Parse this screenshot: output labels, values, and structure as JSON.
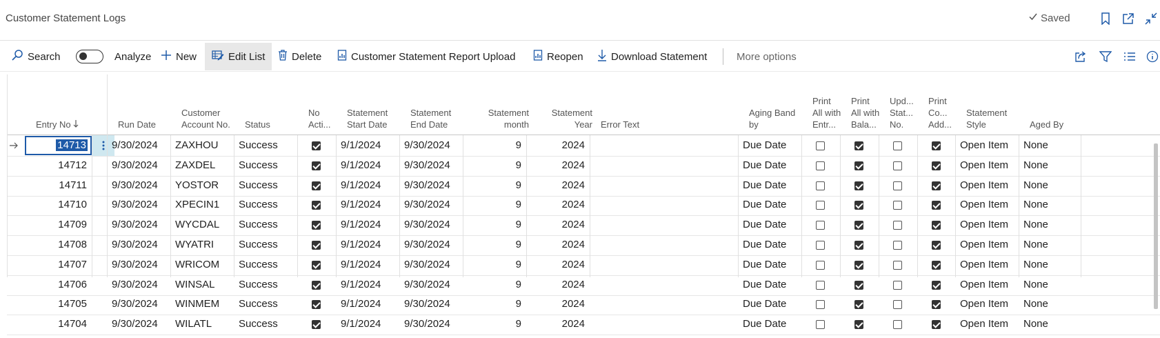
{
  "page": {
    "title": "Customer Statement Logs",
    "saved_label": "Saved"
  },
  "actions": {
    "search": "Search",
    "analyze": "Analyze",
    "new": "New",
    "edit_list": "Edit List",
    "delete": "Delete",
    "upload": "Customer Statement Report Upload",
    "reopen": "Reopen",
    "download": "Download Statement",
    "more": "More options"
  },
  "columns": {
    "entry_no": "Entry No",
    "run_date": "Run Date",
    "customer_account": "Customer Account No.",
    "status": "Status",
    "no_action": "No Acti...",
    "start_date": "Statement Start Date",
    "end_date": "Statement End Date",
    "month": "Statement month",
    "year": "Statement Year",
    "error": "Error Text",
    "aging_band": "Aging Band by",
    "print_all_entries": "Print All with Entr...",
    "print_all_balance": "Print All with Bala...",
    "update_stat": "Upd... Stat... No.",
    "print_company": "Print Co... Add...",
    "style": "Statement Style",
    "aged_by": "Aged By"
  },
  "rows": [
    {
      "entry": "14713",
      "run": "9/30/2024",
      "account": "ZAXHOU",
      "status": "Success",
      "no_action": true,
      "start": "9/1/2024",
      "end": "9/30/2024",
      "month": "9",
      "year": "2024",
      "error": "",
      "aging": "Due Date",
      "p_entries": false,
      "p_balance": true,
      "upd": false,
      "p_company": true,
      "style": "Open Item",
      "aged": "None"
    },
    {
      "entry": "14712",
      "run": "9/30/2024",
      "account": "ZAXDEL",
      "status": "Success",
      "no_action": true,
      "start": "9/1/2024",
      "end": "9/30/2024",
      "month": "9",
      "year": "2024",
      "error": "",
      "aging": "Due Date",
      "p_entries": false,
      "p_balance": true,
      "upd": false,
      "p_company": true,
      "style": "Open Item",
      "aged": "None"
    },
    {
      "entry": "14711",
      "run": "9/30/2024",
      "account": "YOSTOR",
      "status": "Success",
      "no_action": true,
      "start": "9/1/2024",
      "end": "9/30/2024",
      "month": "9",
      "year": "2024",
      "error": "",
      "aging": "Due Date",
      "p_entries": false,
      "p_balance": true,
      "upd": false,
      "p_company": true,
      "style": "Open Item",
      "aged": "None"
    },
    {
      "entry": "14710",
      "run": "9/30/2024",
      "account": "XPECIN1",
      "status": "Success",
      "no_action": true,
      "start": "9/1/2024",
      "end": "9/30/2024",
      "month": "9",
      "year": "2024",
      "error": "",
      "aging": "Due Date",
      "p_entries": false,
      "p_balance": true,
      "upd": false,
      "p_company": true,
      "style": "Open Item",
      "aged": "None"
    },
    {
      "entry": "14709",
      "run": "9/30/2024",
      "account": "WYCDAL",
      "status": "Success",
      "no_action": true,
      "start": "9/1/2024",
      "end": "9/30/2024",
      "month": "9",
      "year": "2024",
      "error": "",
      "aging": "Due Date",
      "p_entries": false,
      "p_balance": true,
      "upd": false,
      "p_company": true,
      "style": "Open Item",
      "aged": "None"
    },
    {
      "entry": "14708",
      "run": "9/30/2024",
      "account": "WYATRI",
      "status": "Success",
      "no_action": true,
      "start": "9/1/2024",
      "end": "9/30/2024",
      "month": "9",
      "year": "2024",
      "error": "",
      "aging": "Due Date",
      "p_entries": false,
      "p_balance": true,
      "upd": false,
      "p_company": true,
      "style": "Open Item",
      "aged": "None"
    },
    {
      "entry": "14707",
      "run": "9/30/2024",
      "account": "WRICOM",
      "status": "Success",
      "no_action": true,
      "start": "9/1/2024",
      "end": "9/30/2024",
      "month": "9",
      "year": "2024",
      "error": "",
      "aging": "Due Date",
      "p_entries": false,
      "p_balance": true,
      "upd": false,
      "p_company": true,
      "style": "Open Item",
      "aged": "None"
    },
    {
      "entry": "14706",
      "run": "9/30/2024",
      "account": "WINSAL",
      "status": "Success",
      "no_action": true,
      "start": "9/1/2024",
      "end": "9/30/2024",
      "month": "9",
      "year": "2024",
      "error": "",
      "aging": "Due Date",
      "p_entries": false,
      "p_balance": true,
      "upd": false,
      "p_company": true,
      "style": "Open Item",
      "aged": "None"
    },
    {
      "entry": "14705",
      "run": "9/30/2024",
      "account": "WINMEM",
      "status": "Success",
      "no_action": true,
      "start": "9/1/2024",
      "end": "9/30/2024",
      "month": "9",
      "year": "2024",
      "error": "",
      "aging": "Due Date",
      "p_entries": false,
      "p_balance": true,
      "upd": false,
      "p_company": true,
      "style": "Open Item",
      "aged": "None"
    },
    {
      "entry": "14704",
      "run": "9/30/2024",
      "account": "WILATL",
      "status": "Success",
      "no_action": true,
      "start": "9/1/2024",
      "end": "9/30/2024",
      "month": "9",
      "year": "2024",
      "error": "",
      "aging": "Due Date",
      "p_entries": false,
      "p_balance": true,
      "upd": false,
      "p_company": true,
      "style": "Open Item",
      "aged": "None"
    }
  ]
}
